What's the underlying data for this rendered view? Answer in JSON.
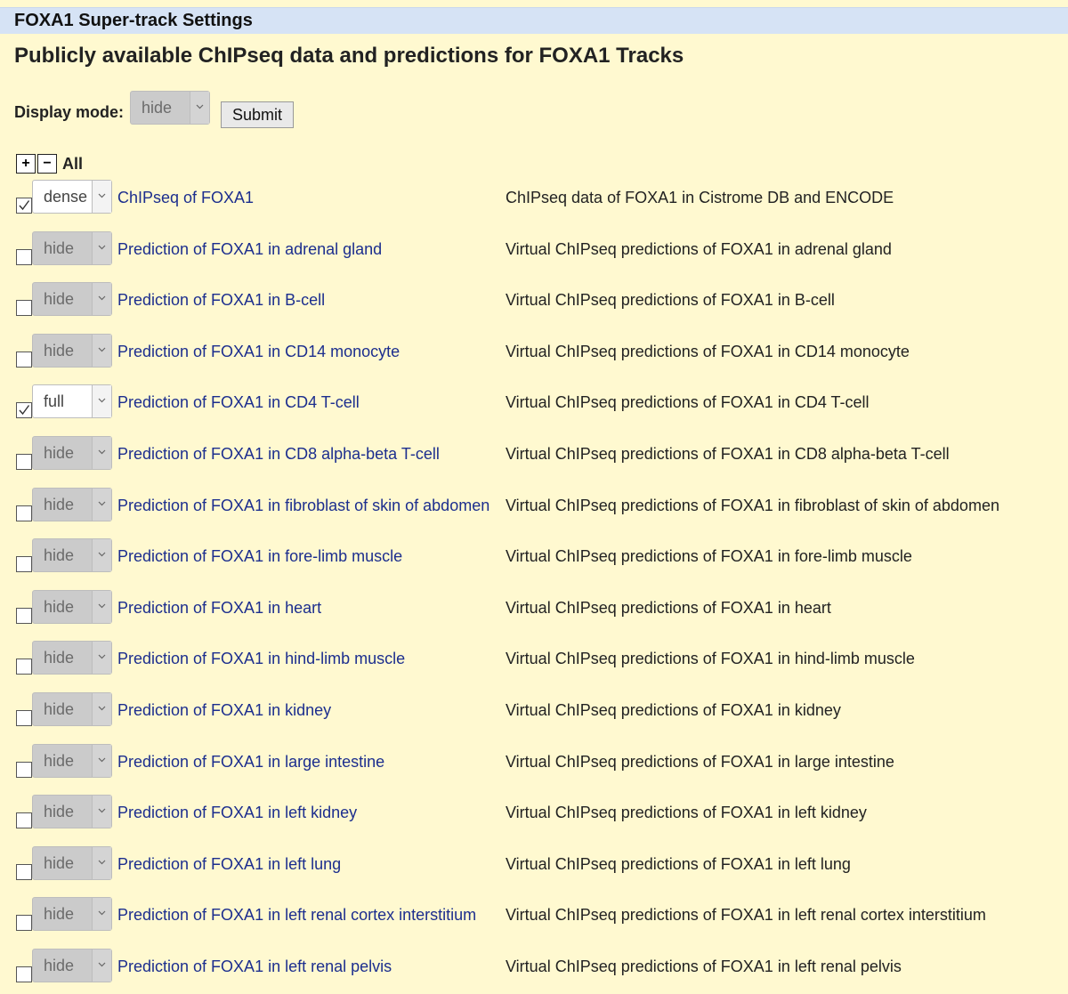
{
  "header": {
    "title": "FOXA1 Super-track Settings"
  },
  "page_title": "Publicly available ChIPseq data and predictions for FOXA1 Tracks",
  "display_mode": {
    "label": "Display mode:",
    "value": "hide",
    "submit_label": "Submit"
  },
  "all_toggle": {
    "plus": "+",
    "minus": "−",
    "label": "All"
  },
  "tracks": [
    {
      "checked": true,
      "mode": "dense",
      "enabled": true,
      "label": "ChIPseq of FOXA1",
      "description": "ChIPseq data of FOXA1 in Cistrome DB and ENCODE"
    },
    {
      "checked": false,
      "mode": "hide",
      "enabled": false,
      "label": "Prediction of FOXA1 in adrenal gland",
      "description": "Virtual ChIPseq predictions of FOXA1 in adrenal gland"
    },
    {
      "checked": false,
      "mode": "hide",
      "enabled": false,
      "label": "Prediction of FOXA1 in B-cell",
      "description": "Virtual ChIPseq predictions of FOXA1 in B-cell"
    },
    {
      "checked": false,
      "mode": "hide",
      "enabled": false,
      "label": "Prediction of FOXA1 in CD14 monocyte",
      "description": "Virtual ChIPseq predictions of FOXA1 in CD14 monocyte"
    },
    {
      "checked": true,
      "mode": "full",
      "enabled": true,
      "label": "Prediction of FOXA1 in CD4 T-cell",
      "description": "Virtual ChIPseq predictions of FOXA1 in CD4 T-cell"
    },
    {
      "checked": false,
      "mode": "hide",
      "enabled": false,
      "label": "Prediction of FOXA1 in CD8 alpha-beta T-cell",
      "description": "Virtual ChIPseq predictions of FOXA1 in CD8 alpha-beta T-cell"
    },
    {
      "checked": false,
      "mode": "hide",
      "enabled": false,
      "label": "Prediction of FOXA1 in fibroblast of skin of abdomen",
      "description": "Virtual ChIPseq predictions of FOXA1 in fibroblast of skin of abdomen"
    },
    {
      "checked": false,
      "mode": "hide",
      "enabled": false,
      "label": "Prediction of FOXA1 in fore-limb muscle",
      "description": "Virtual ChIPseq predictions of FOXA1 in fore-limb muscle"
    },
    {
      "checked": false,
      "mode": "hide",
      "enabled": false,
      "label": "Prediction of FOXA1 in heart",
      "description": "Virtual ChIPseq predictions of FOXA1 in heart"
    },
    {
      "checked": false,
      "mode": "hide",
      "enabled": false,
      "label": "Prediction of FOXA1 in hind-limb muscle",
      "description": "Virtual ChIPseq predictions of FOXA1 in hind-limb muscle"
    },
    {
      "checked": false,
      "mode": "hide",
      "enabled": false,
      "label": "Prediction of FOXA1 in kidney",
      "description": "Virtual ChIPseq predictions of FOXA1 in kidney"
    },
    {
      "checked": false,
      "mode": "hide",
      "enabled": false,
      "label": "Prediction of FOXA1 in large intestine",
      "description": "Virtual ChIPseq predictions of FOXA1 in large intestine"
    },
    {
      "checked": false,
      "mode": "hide",
      "enabled": false,
      "label": "Prediction of FOXA1 in left kidney",
      "description": "Virtual ChIPseq predictions of FOXA1 in left kidney"
    },
    {
      "checked": false,
      "mode": "hide",
      "enabled": false,
      "label": "Prediction of FOXA1 in left lung",
      "description": "Virtual ChIPseq predictions of FOXA1 in left lung"
    },
    {
      "checked": false,
      "mode": "hide",
      "enabled": false,
      "label": "Prediction of FOXA1 in left renal cortex interstitium",
      "description": "Virtual ChIPseq predictions of FOXA1 in left renal cortex interstitium"
    },
    {
      "checked": false,
      "mode": "hide",
      "enabled": false,
      "label": "Prediction of FOXA1 in left renal pelvis",
      "description": "Virtual ChIPseq predictions of FOXA1 in left renal pelvis"
    }
  ]
}
